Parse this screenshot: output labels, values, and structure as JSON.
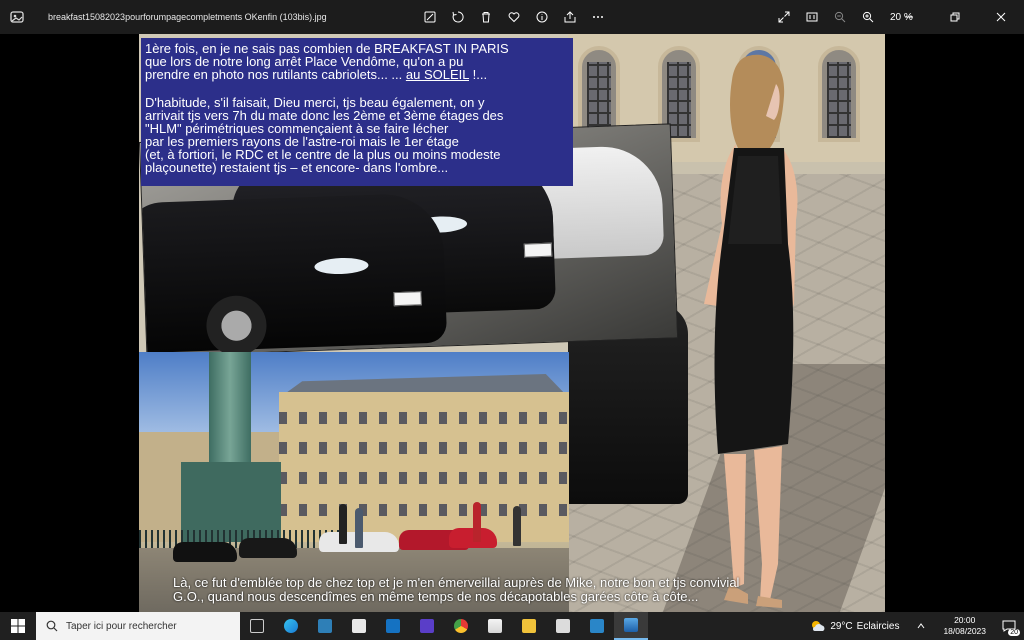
{
  "window": {
    "title": "breakfast15082023pourforumpagecompletments OKenfin (103bis).jpg",
    "zoom": "20 %"
  },
  "photo": {
    "text_top": [
      "1ère fois, en je ne sais pas combien de BREAKFAST IN PARIS",
      "que lors de notre long arrêt Place Vendôme, qu'on a pu",
      "prendre en photo nos rutilants cabriolets... ... ",
      "au SOLEIL",
      " !...",
      "D'habitude, s'il faisait, Dieu merci, tjs beau également,  on y",
      "arrivait tjs vers 7h du mate donc les 2ème et 3ème étages  des",
      "\"HLM\" périmétriques commençaient à se faire lécher",
      "par les premiers rayons de l'astre-roi mais le 1er étage",
      "(et, à fortiori, le RDC et le centre de la plus ou moins modeste",
      "plaçounette) restaient tjs – et encore- dans l'ombre..."
    ],
    "text_bottom": [
      "Là, ce fut d'emblée top de chez top  et je m'en émerveillai auprès de Mike, notre bon et tjs convivial",
      "G.O., quand nous descendîmes en même temps de nos décapotables garées côte à côte..."
    ]
  },
  "taskbar": {
    "search_placeholder": "Taper ici pour rechercher",
    "weather_temp": "29°C",
    "weather_text": "Eclaircies",
    "time": "20:00",
    "date": "18/08/2023",
    "notif_count": "20"
  }
}
